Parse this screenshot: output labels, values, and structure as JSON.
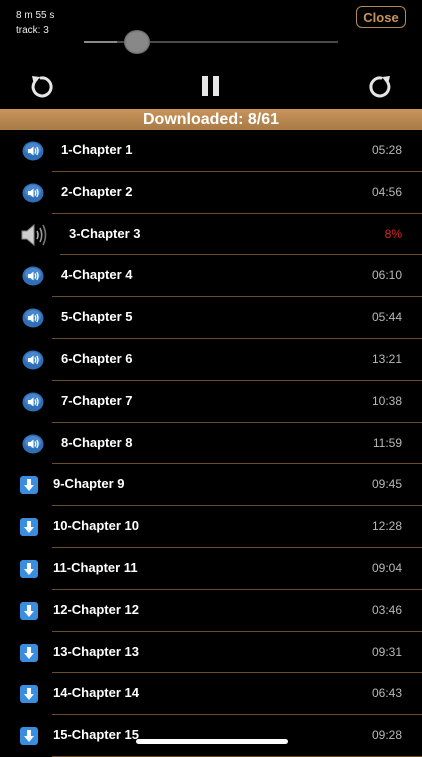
{
  "player": {
    "elapsed": "8 m 55 s",
    "track": "track: 3",
    "close_label": "Close",
    "progress": 0.13
  },
  "banner": {
    "text": "Downloaded: 8/61"
  },
  "icons": {
    "rewind": "rewind-icon",
    "pause": "pause-icon",
    "forward": "forward-icon",
    "downloaded": "speaker-badge-icon",
    "playing": "speaker-sound-icon",
    "download": "download-arrow-icon"
  },
  "colors": {
    "accent": "#c8955b",
    "percent": "#e02020"
  },
  "tracks": [
    {
      "title": "1-Chapter 1",
      "duration": "05:28",
      "state": "downloaded"
    },
    {
      "title": "2-Chapter 2",
      "duration": "04:56",
      "state": "downloaded"
    },
    {
      "title": "3-Chapter 3",
      "duration": "8%",
      "state": "playing"
    },
    {
      "title": "4-Chapter 4",
      "duration": "06:10",
      "state": "downloaded"
    },
    {
      "title": "5-Chapter 5",
      "duration": "05:44",
      "state": "downloaded"
    },
    {
      "title": "6-Chapter 6",
      "duration": "13:21",
      "state": "downloaded"
    },
    {
      "title": "7-Chapter 7",
      "duration": "10:38",
      "state": "downloaded"
    },
    {
      "title": "8-Chapter 8",
      "duration": "11:59",
      "state": "downloaded"
    },
    {
      "title": "9-Chapter 9",
      "duration": "09:45",
      "state": "download"
    },
    {
      "title": "10-Chapter 10",
      "duration": "12:28",
      "state": "download"
    },
    {
      "title": "11-Chapter 11",
      "duration": "09:04",
      "state": "download"
    },
    {
      "title": "12-Chapter 12",
      "duration": "03:46",
      "state": "download"
    },
    {
      "title": "13-Chapter 13",
      "duration": "09:31",
      "state": "download"
    },
    {
      "title": "14-Chapter 14",
      "duration": "06:43",
      "state": "download"
    },
    {
      "title": "15-Chapter 15",
      "duration": "09:28",
      "state": "download"
    }
  ]
}
